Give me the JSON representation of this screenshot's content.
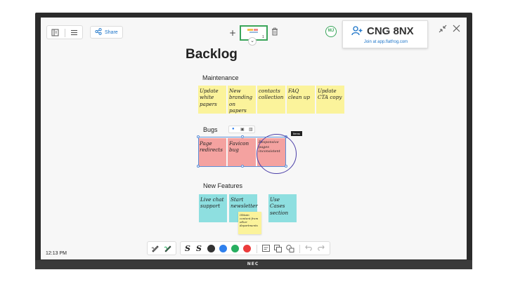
{
  "device": {
    "brand": "NEC"
  },
  "toolbar": {
    "share_label": "Share",
    "share_icon": "share-icon",
    "left_icons": [
      "sidebar-icon",
      "menu-icon"
    ]
  },
  "page_nav": {
    "add_label": "+",
    "page_number": "1",
    "trash_icon": "trash-icon",
    "chevron": "⌄"
  },
  "session": {
    "avatar_initials": "MJ",
    "code": "CNG 8NX",
    "join_text": "Join at app.flatfrog.com"
  },
  "board": {
    "title": "Backlog",
    "sections": [
      {
        "label": "Maintenance",
        "notes": [
          {
            "text": "Update white papers",
            "color": "yellow"
          },
          {
            "text": "New branding on papers",
            "color": "yellow"
          },
          {
            "text": "contacts collection",
            "color": "yellow"
          },
          {
            "text": "FAQ clean up",
            "color": "yellow"
          },
          {
            "text": "Update CTA copy",
            "color": "yellow"
          }
        ]
      },
      {
        "label": "Bugs",
        "notes": [
          {
            "text": "Page redirects",
            "color": "pink"
          },
          {
            "text": "Favicon bug",
            "color": "pink"
          },
          {
            "text": "Responsive pages inconsistent",
            "color": "pink"
          }
        ]
      },
      {
        "label": "New Features",
        "notes": [
          {
            "text": "Live chat support",
            "color": "cyan"
          },
          {
            "text": "Start newsletter",
            "color": "cyan"
          },
          {
            "text": "Use Cases section",
            "color": "cyan"
          }
        ]
      }
    ],
    "small_note": "Obtain content from other departments",
    "selection_tools": [
      "info-icon",
      "lock-icon",
      "trash-icon"
    ],
    "tooltip": "Items"
  },
  "status": {
    "time": "12:13 PM"
  },
  "tools": {
    "pens": [
      "pen-icon",
      "highlighter-icon"
    ],
    "colors": [
      "#333333",
      "#2f80ed",
      "#27ae60",
      "#eb3b3b"
    ],
    "actions": [
      "sticky-note-icon",
      "copy-icon",
      "shapes-icon"
    ],
    "undo_redo": [
      "undo-icon",
      "redo-icon"
    ]
  },
  "colors": {
    "yellow": "#fbf39b",
    "pink": "#f4a2a0",
    "cyan": "#8edfe0",
    "accent": "#1a73c8",
    "present": "#3aa55a"
  }
}
